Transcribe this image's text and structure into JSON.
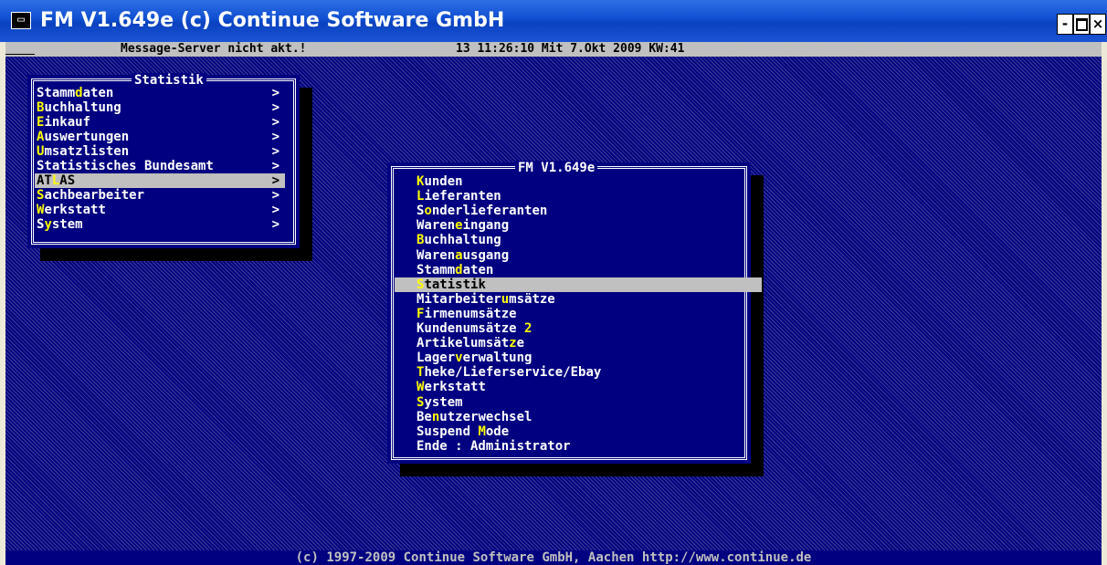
{
  "window": {
    "icon_glyph": "▭",
    "title": "FM V1.649e (c) Continue Software GmbH",
    "minimize": "-",
    "close": "×"
  },
  "statusbar": {
    "message": "Message-Server nicht akt.!",
    "datetime": "13 11:26:10 Mit 7.Okt 2009 KW:41"
  },
  "statistik_menu": {
    "title": "Statistik",
    "arrow": ">",
    "items": [
      {
        "pre": "Stamm",
        "hk": "d",
        "post": "aten"
      },
      {
        "pre": "",
        "hk": "B",
        "post": "uchhaltung"
      },
      {
        "pre": "",
        "hk": "E",
        "post": "inkauf"
      },
      {
        "pre": "",
        "hk": "A",
        "post": "uswertungen"
      },
      {
        "pre": "",
        "hk": "U",
        "post": "msatzlisten"
      },
      {
        "pre": "Statistisches Bundesamt",
        "hk": "",
        "post": ""
      },
      {
        "pre": "AT",
        "hk": "L",
        "post": "AS"
      },
      {
        "pre": "",
        "hk": "S",
        "post": "achbearbeiter"
      },
      {
        "pre": "",
        "hk": "W",
        "post": "erkstatt"
      },
      {
        "pre": "S",
        "hk": "y",
        "post": "stem"
      }
    ]
  },
  "main_menu": {
    "title": "FM V1.649e",
    "items": [
      {
        "pre": "",
        "hk": "K",
        "post": "unden"
      },
      {
        "pre": "",
        "hk": "L",
        "post": "ieferanten"
      },
      {
        "pre": "S",
        "hk": "o",
        "post": "nderlieferanten"
      },
      {
        "pre": "Waren",
        "hk": "e",
        "post": "ingang"
      },
      {
        "pre": "",
        "hk": "B",
        "post": "uchhaltung"
      },
      {
        "pre": "Waren",
        "hk": "a",
        "post": "usgang"
      },
      {
        "pre": "Stamm",
        "hk": "d",
        "post": "aten"
      },
      {
        "pre": "",
        "hk": "S",
        "post": "tatistik"
      },
      {
        "pre": "Mitarbeiter",
        "hk": "u",
        "post": "msätze"
      },
      {
        "pre": "",
        "hk": "F",
        "post": "irmenumsätze"
      },
      {
        "pre": "Kundenumsätze ",
        "hk": "2",
        "post": ""
      },
      {
        "pre": "Artikelumsät",
        "hk": "z",
        "post": "e"
      },
      {
        "pre": "Lager",
        "hk": "v",
        "post": "erwaltung"
      },
      {
        "pre": "",
        "hk": "T",
        "post": "heke/Lieferservice/Ebay"
      },
      {
        "pre": "",
        "hk": "W",
        "post": "erkstatt"
      },
      {
        "pre": "",
        "hk": "S",
        "post": "ystem"
      },
      {
        "pre": "Be",
        "hk": "n",
        "post": "utzerwechsel"
      },
      {
        "pre": "Suspend ",
        "hk": "M",
        "post": "ode"
      },
      {
        "pre": "Ende : Administrator",
        "hk": "",
        "post": ""
      }
    ]
  },
  "footer": "(c) 1997-2009 Continue Software GmbH, Aachen http://www.continue.de",
  "colors": {
    "background": "#000080",
    "text": "#ffffff",
    "hotkey": "#ffff00",
    "selection": "#c0c0c0"
  }
}
